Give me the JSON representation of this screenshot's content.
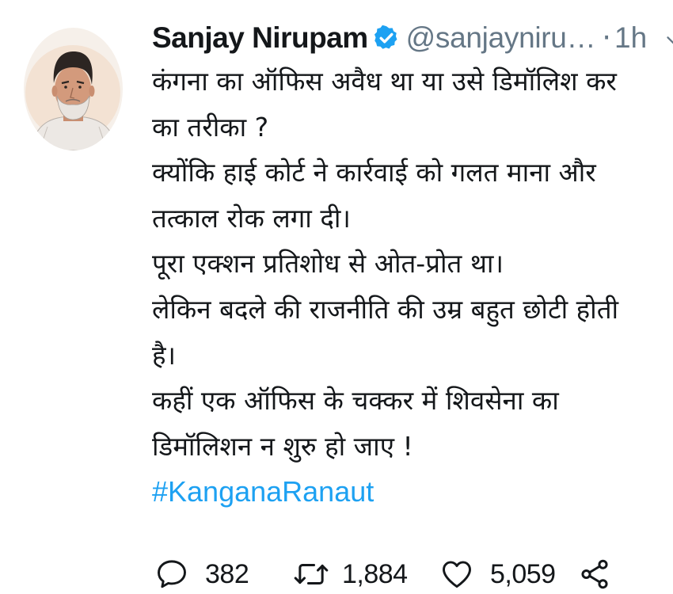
{
  "tweet": {
    "author": {
      "name": "Sanjay Nirupam",
      "handle": "@sanjayniru…",
      "verified": true,
      "avatar_icon": "person-illustration-avatar"
    },
    "separator": "·",
    "timestamp": "1h",
    "body_lines": [
      "कंगना का ऑफिस अवैध था या उसे डिमॉलिश कर",
      "का तरीका ?",
      "क्योंकि हाई कोर्ट ने कार्रवाई को गलत माना और",
      "तत्काल रोक लगा दी।",
      "पूरा एक्शन प्रतिशोध से ओत-प्रोत था।",
      "लेकिन बदले की राजनीति की उम्र बहुत छोटी होती",
      "है।",
      "कहीं एक ऑफिस के चक्कर में शिवसेना का",
      "डिमॉलिशन न शुरु हो जाए !"
    ],
    "hashtag": "#KanganaRanaut",
    "actions": {
      "reply": {
        "icon": "reply-icon",
        "count": "382"
      },
      "retweet": {
        "icon": "retweet-icon",
        "count": "1,884"
      },
      "like": {
        "icon": "heart-icon",
        "count": "5,059"
      },
      "share": {
        "icon": "share-icon"
      }
    },
    "colors": {
      "text": "#14171a",
      "secondary": "#657786",
      "link": "#1da1f2",
      "verified": "#1da1f2"
    }
  }
}
